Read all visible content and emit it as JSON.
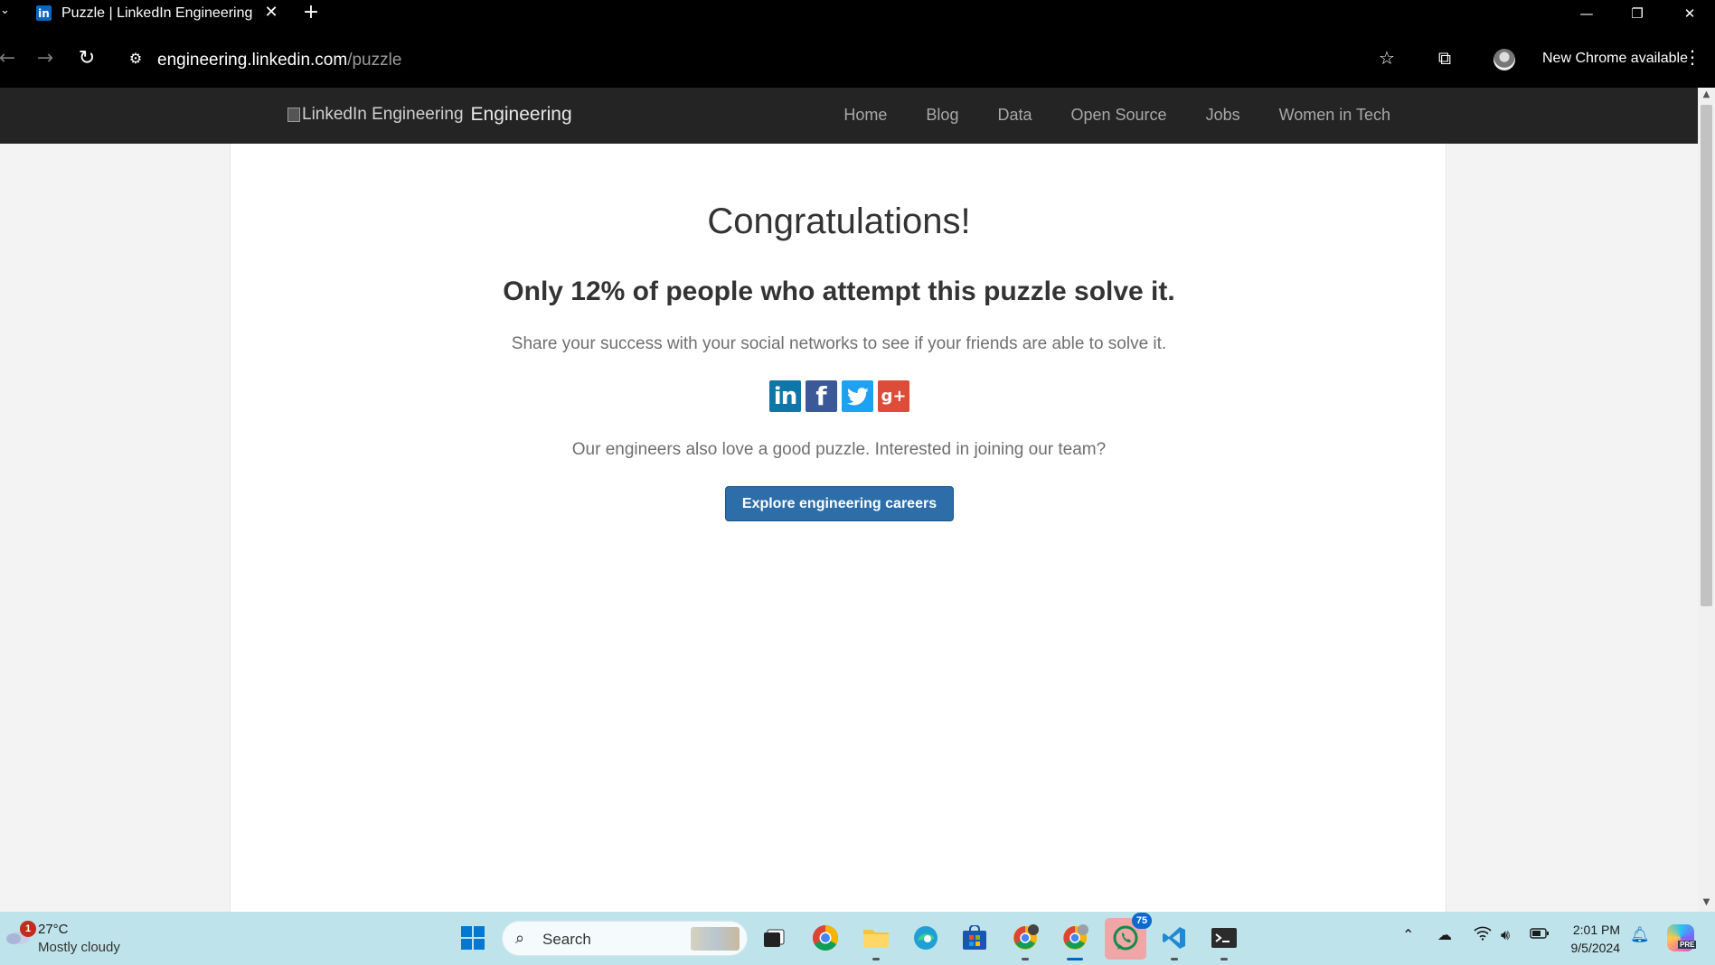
{
  "browser": {
    "tab": {
      "favicon": "in",
      "title": "Puzzle | LinkedIn Engineering"
    },
    "url": {
      "host": "engineering.linkedin.com",
      "path": "/puzzle"
    },
    "update_label": "New Chrome available"
  },
  "site": {
    "brand_alt": "LinkedIn Engineering",
    "brand_text": "Engineering",
    "nav": [
      {
        "label": "Home"
      },
      {
        "label": "Blog"
      },
      {
        "label": "Data"
      },
      {
        "label": "Open Source"
      },
      {
        "label": "Jobs"
      },
      {
        "label": "Women in Tech"
      }
    ]
  },
  "content": {
    "headline": "Congratulations!",
    "subheadline": "Only 12% of people who attempt this puzzle solve it.",
    "share_prompt": "Share your success with your social networks to see if your friends are able to solve it.",
    "share_icons": [
      {
        "name": "linkedin-icon",
        "glyph": "in",
        "color": "#0e76a8"
      },
      {
        "name": "facebook-icon",
        "glyph": "f",
        "color": "#3b5998"
      },
      {
        "name": "twitter-icon",
        "glyph": "🐦",
        "color": "#1da1f2"
      },
      {
        "name": "google-plus-icon",
        "glyph": "g+",
        "color": "#dd4b39"
      }
    ],
    "team_prompt": "Our engineers also love a good puzzle. Interested in joining our team?",
    "cta_label": "Explore engineering careers",
    "cta_color": "#2d6da8"
  },
  "taskbar": {
    "weather": {
      "badge": "1",
      "temperature": "27°C",
      "condition": "Mostly cloudy"
    },
    "search_label": "Search",
    "whatsapp_badge": "75",
    "clock": {
      "time": "2:01 PM",
      "date": "9/5/2024"
    },
    "copilot_tag": "PRE"
  }
}
